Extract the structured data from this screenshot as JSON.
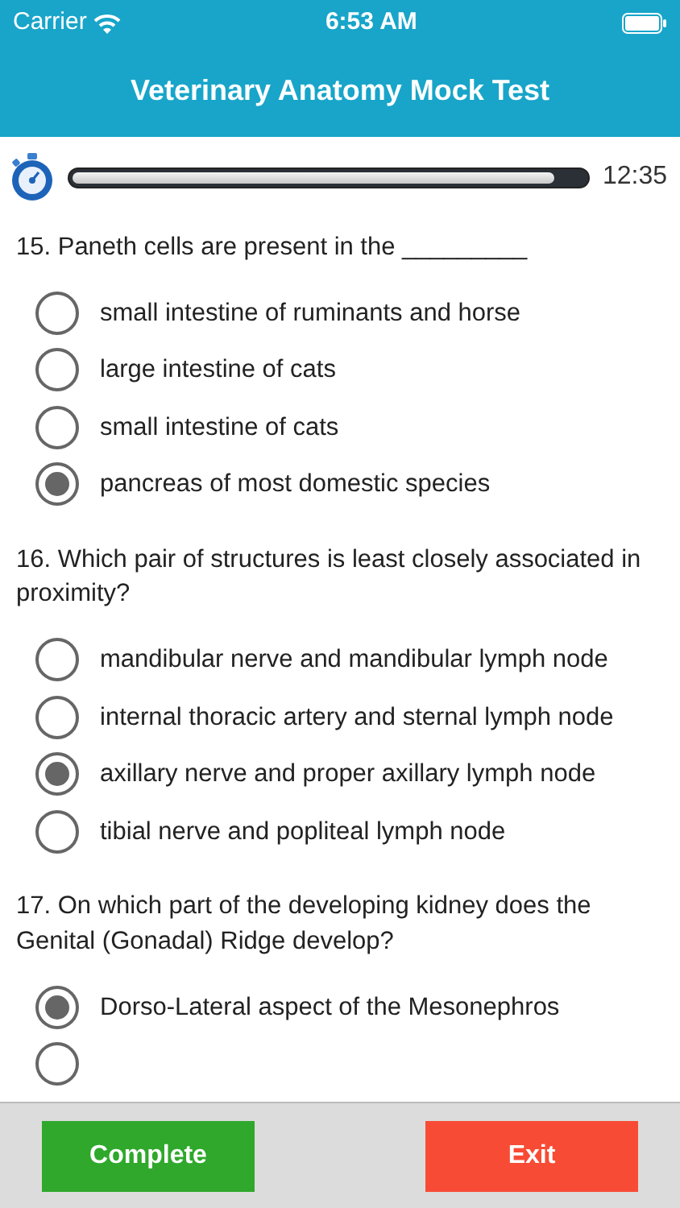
{
  "status_bar": {
    "carrier": "Carrier",
    "time": "6:53 AM"
  },
  "title": "Veterinary Anatomy Mock Test",
  "timer": {
    "level": 0.94,
    "reading": "12:35"
  },
  "questions": [
    {
      "text": "15. Paneth cells are present in the _________",
      "options": [
        {
          "label": "small intestine of ruminants and horse",
          "selected": false
        },
        {
          "label": "large intestine of cats",
          "selected": false
        },
        {
          "label": "small intestine of cats",
          "selected": false
        },
        {
          "label": "pancreas of most domestic species",
          "selected": true
        }
      ]
    },
    {
      "text": "16. Which pair of structures is least closely associated in proximity?",
      "options": [
        {
          "label": "mandibular nerve and mandibular lymph node",
          "selected": false
        },
        {
          "label": "internal thoracic artery and sternal lymph node",
          "selected": false
        },
        {
          "label": "axillary nerve and proper axillary lymph node",
          "selected": true
        },
        {
          "label": "tibial nerve and popliteal lymph node",
          "selected": false
        }
      ]
    },
    {
      "text": "17. On which part of the developing kidney does the Genital (Gonadal) Ridge develop?",
      "options": [
        {
          "label": "Dorso-Lateral aspect of the Mesonephros",
          "selected": true
        },
        {
          "selected": false
        }
      ]
    }
  ],
  "buttons": [
    {
      "label": "Complete",
      "kind": "complete"
    },
    {
      "label": "Exit",
      "kind": "exit"
    }
  ]
}
